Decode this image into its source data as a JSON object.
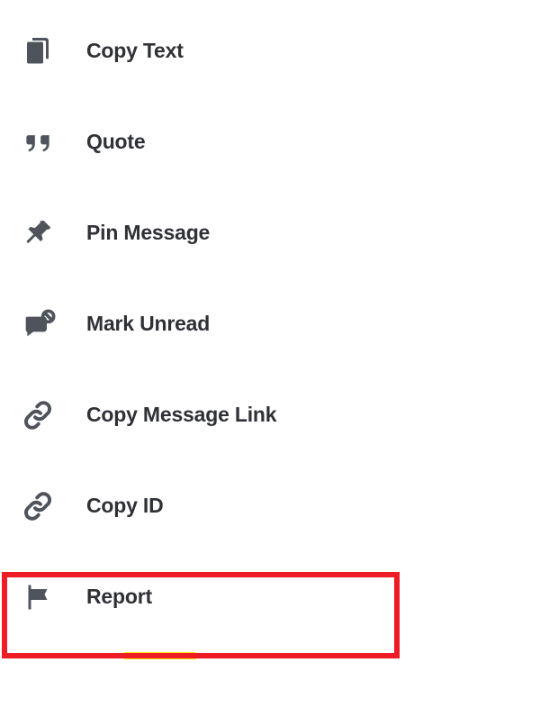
{
  "menu": {
    "items": [
      {
        "label": "Copy Text"
      },
      {
        "label": "Quote"
      },
      {
        "label": "Pin Message"
      },
      {
        "label": "Mark Unread"
      },
      {
        "label": "Copy Message Link"
      },
      {
        "label": "Copy ID"
      },
      {
        "label": "Report"
      }
    ]
  },
  "colors": {
    "icon": "#4f545c",
    "text": "#2f3136",
    "highlight_border": "#ee1c24",
    "highlight_underline": "#ffe600"
  }
}
